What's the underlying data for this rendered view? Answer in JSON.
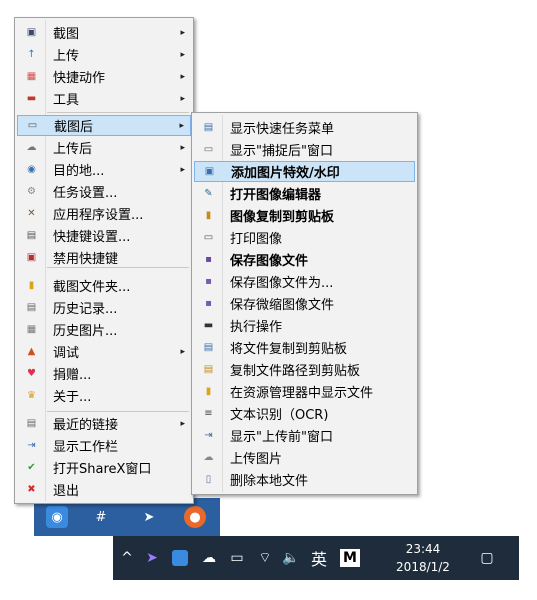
{
  "menu1": {
    "items": [
      {
        "label": "截图",
        "icon": "screenshot-icon",
        "arrow": "▸"
      },
      {
        "label": "上传",
        "icon": "upload-icon",
        "arrow": "▸"
      },
      {
        "label": "快捷动作",
        "icon": "quick-actions-icon",
        "arrow": "▸"
      },
      {
        "label": "工具",
        "icon": "toolbox-icon",
        "arrow": "▸"
      },
      {
        "label": "截图后",
        "icon": "after-capture-icon",
        "arrow": "▸"
      },
      {
        "label": "上传后",
        "icon": "after-upload-icon",
        "arrow": "▸"
      },
      {
        "label": "目的地...",
        "icon": "destinations-icon",
        "arrow": "▸"
      },
      {
        "label": "任务设置...",
        "icon": "task-settings-icon"
      },
      {
        "label": "应用程序设置...",
        "icon": "app-settings-icon"
      },
      {
        "label": "快捷键设置...",
        "icon": "hotkey-settings-icon"
      },
      {
        "label": "禁用快捷键",
        "icon": "disable-hotkeys-icon"
      },
      {
        "label": "截图文件夹...",
        "icon": "folder-icon"
      },
      {
        "label": "历史记录...",
        "icon": "history-icon"
      },
      {
        "label": "历史图片...",
        "icon": "image-history-icon"
      },
      {
        "label": "调试",
        "icon": "debug-icon",
        "arrow": "▸"
      },
      {
        "label": "捐赠...",
        "icon": "heart-icon"
      },
      {
        "label": "关于...",
        "icon": "crown-icon"
      },
      {
        "label": "最近的链接",
        "icon": "recent-links-icon",
        "arrow": "▸"
      },
      {
        "label": "显示工作栏",
        "icon": "show-taskbar-icon"
      },
      {
        "label": "打开ShareX窗口",
        "icon": "check-icon"
      },
      {
        "label": "退出",
        "icon": "exit-icon"
      }
    ]
  },
  "menu2": {
    "items": [
      {
        "label": "显示快速任务菜单",
        "icon": "task-menu-icon"
      },
      {
        "label": "显示\"捕捉后\"窗口",
        "icon": "window-icon"
      },
      {
        "label": "添加图片特效/水印",
        "icon": "effects-icon",
        "bold": true
      },
      {
        "label": "打开图像编辑器",
        "icon": "image-editor-icon",
        "bold": true
      },
      {
        "label": "图像复制到剪贴板",
        "icon": "clipboard-icon",
        "bold": true
      },
      {
        "label": "打印图像",
        "icon": "printer-icon"
      },
      {
        "label": "保存图像文件",
        "icon": "save-icon",
        "bold": true
      },
      {
        "label": "保存图像文件为...",
        "icon": "save-as-icon"
      },
      {
        "label": "保存微缩图像文件",
        "icon": "save-thumbnail-icon"
      },
      {
        "label": "执行操作",
        "icon": "terminal-icon"
      },
      {
        "label": "将文件复制到剪贴板",
        "icon": "copy-file-icon"
      },
      {
        "label": "复制文件路径到剪贴板",
        "icon": "copy-path-icon"
      },
      {
        "label": "在资源管理器中显示文件",
        "icon": "explorer-icon"
      },
      {
        "label": "文本识别（OCR)",
        "icon": "ocr-icon"
      },
      {
        "label": "显示\"上传前\"窗口",
        "icon": "before-upload-icon"
      },
      {
        "label": "上传图片",
        "icon": "upload-image-icon"
      },
      {
        "label": "删除本地文件",
        "icon": "delete-file-icon"
      }
    ]
  },
  "taskbar": {
    "ime": "英",
    "ime_mode": "M",
    "time": "23:44",
    "date": "2018/1/2"
  },
  "colors": {
    "highlight": "#cce4f7",
    "taskbar": "#1e2c3c",
    "tray_strip": "#2b5fa0"
  }
}
